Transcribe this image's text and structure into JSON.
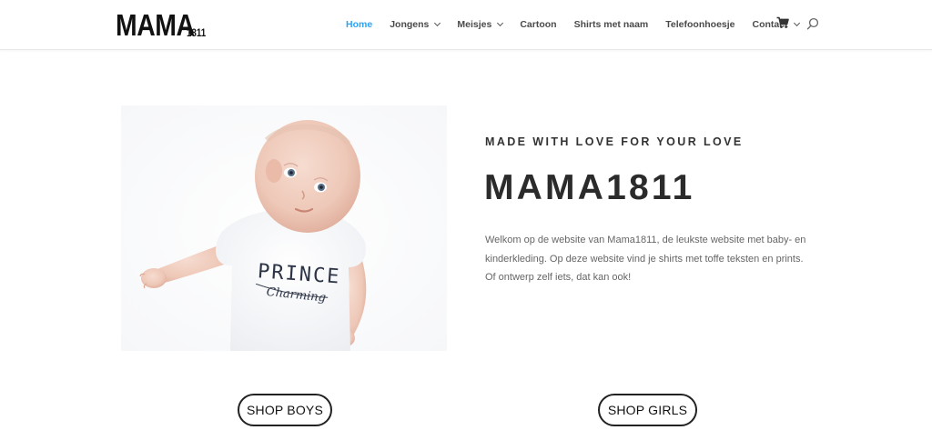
{
  "header": {
    "logo_main": "MAMA",
    "logo_sub": "1811",
    "nav": [
      {
        "label": "Home",
        "active": true,
        "dropdown": false
      },
      {
        "label": "Jongens",
        "active": false,
        "dropdown": true
      },
      {
        "label": "Meisjes",
        "active": false,
        "dropdown": true
      },
      {
        "label": "Cartoon",
        "active": false,
        "dropdown": false
      },
      {
        "label": "Shirts met naam",
        "active": false,
        "dropdown": false
      },
      {
        "label": "Telefoonhoesje",
        "active": false,
        "dropdown": false
      },
      {
        "label": "Contact",
        "active": false,
        "dropdown": true
      }
    ],
    "cart_icon": "cart-icon",
    "search_icon": "search-icon"
  },
  "hero": {
    "image_alt": "baby-in-prince-charming-shirt",
    "shirt_text_line1": "PRINCE",
    "shirt_text_line2": "Charming",
    "tagline": "MADE WITH LOVE FOR YOUR LOVE",
    "headline": "MAMA1811",
    "intro_line1": "Welkom op de website van Mama1811, de leukste website met baby- en",
    "intro_line2": "kinderkleding. Op deze website vind je shirts met toffe teksten en prints.",
    "intro_line3": "Of ontwerp zelf iets, dat kan ook!"
  },
  "buttons": {
    "shop_boys": "SHOP BOYS",
    "shop_girls": "SHOP GIRLS"
  },
  "colors": {
    "accent": "#2ea3f2",
    "text_dark": "#2b2b2b",
    "text_body": "#666666"
  }
}
